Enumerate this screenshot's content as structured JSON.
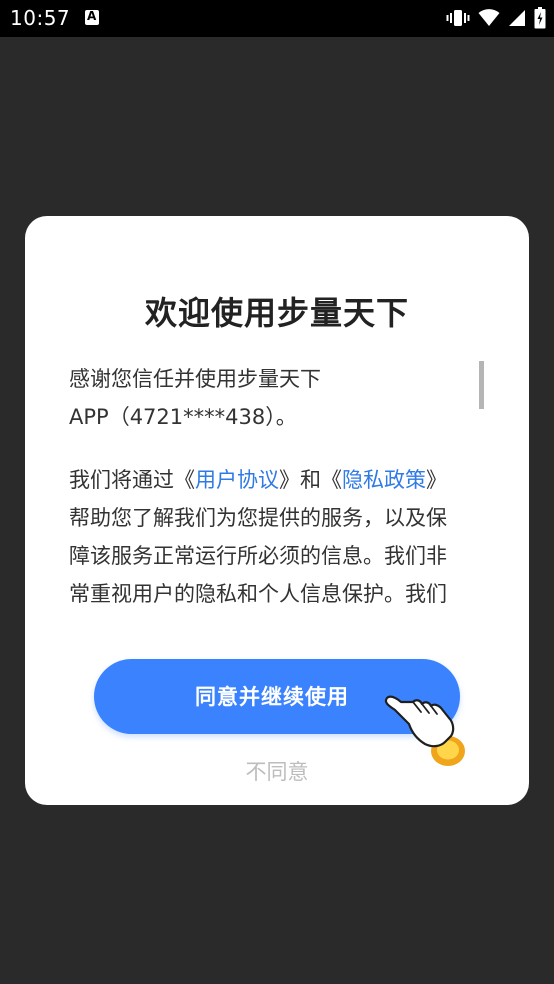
{
  "status_bar": {
    "time": "10:57"
  },
  "dialog": {
    "title": "欢迎使用步量天下",
    "intro_line1": "感谢您信任并使用步量天下",
    "intro_line2": "APP（4721****438）。",
    "policy_text_prefix": "我们将通过《",
    "user_agreement_link": "用户协议",
    "policy_text_and": "》和《",
    "privacy_policy_link": "隐私政策",
    "policy_text_close": "》",
    "policy_line2": "帮助您了解我们为您提供的服务，以及保",
    "policy_line3": "障该服务正常运行所必须的信息。我们非",
    "policy_line4": "常重视用户的隐私和个人信息保护。我们",
    "agree_button": "同意并继续使用",
    "disagree_link": "不同意"
  },
  "colors": {
    "accent": "#3b82ff",
    "link": "#2f7ae5",
    "overlay": "#2a2a2a"
  }
}
